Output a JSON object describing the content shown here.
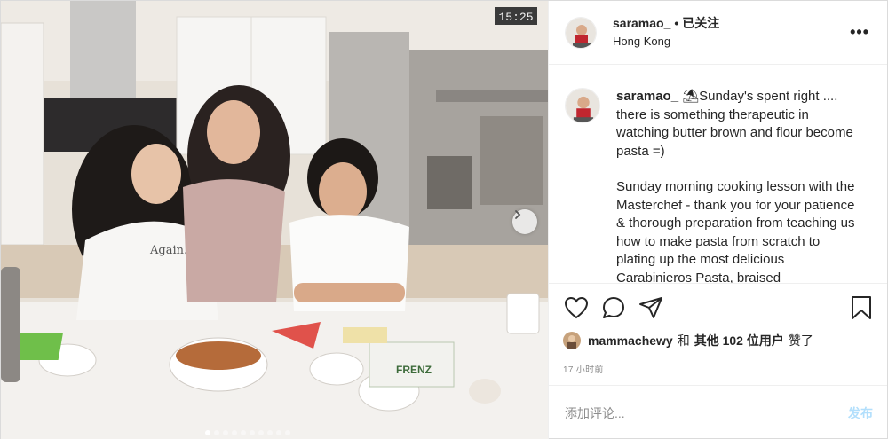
{
  "header": {
    "username": "saramao_",
    "separator": "•",
    "follow_status": "已关注",
    "location": "Hong Kong",
    "more_label": "•••"
  },
  "photo": {
    "clock_text": "15:25",
    "carousel_total": 10,
    "carousel_active": 1
  },
  "caption": {
    "username": "saramao_",
    "paragraphs": [
      "⛱Sunday's spent right .... there is something therapeutic in watching butter brown and flour become pasta =)",
      "Sunday morning cooking lesson with the Masterchef - thank you for your patience & thorough preparation from teaching us how to make pasta from scratch to plating up the most delicious Carabinieros Pasta, braised"
    ]
  },
  "actions": {
    "icons": [
      "heart-icon",
      "comment-icon",
      "share-icon",
      "bookmark-icon"
    ]
  },
  "likes": {
    "user": "mammachewy",
    "and": "和",
    "others": "其他 102 位用户",
    "liked": "赞了"
  },
  "timestamp": "17 小时前",
  "comment_box": {
    "placeholder": "添加评论...",
    "post_label": "发布"
  },
  "colors": {
    "post_disabled": "#b2dffc",
    "border": "#efefef",
    "muted": "#8e8e8e"
  }
}
